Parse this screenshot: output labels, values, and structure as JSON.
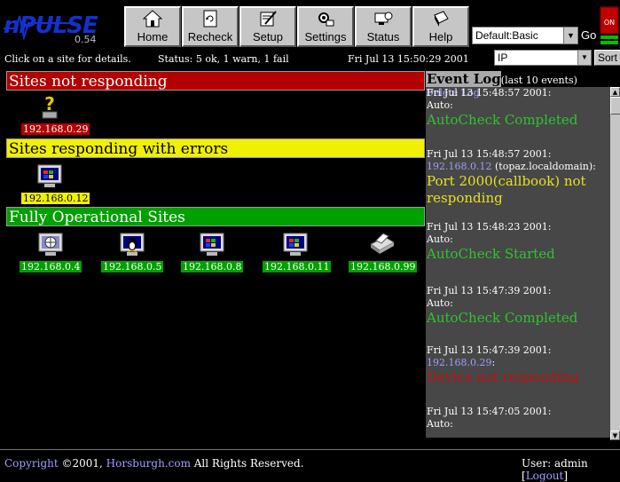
{
  "header": {
    "logo_text": "nPULSE",
    "version": "0.54",
    "nav": [
      {
        "label": "Home",
        "icon": "house-icon"
      },
      {
        "label": "Recheck",
        "icon": "recheck-icon"
      },
      {
        "label": "Setup",
        "icon": "setup-icon"
      },
      {
        "label": "Settings",
        "icon": "settings-icon"
      },
      {
        "label": "Status",
        "icon": "status-icon"
      },
      {
        "label": "Help",
        "icon": "help-book-icon"
      }
    ],
    "view_select": "Default:Basic",
    "go_label": "Go",
    "power_label": "ON"
  },
  "statusbar": {
    "hint": "Click on a site for details.",
    "status": "Status: 5 ok, 1 warn, 1 fail",
    "datetime": "Fri Jul 13 15:50:29 2001",
    "sort_select": "IP",
    "sort_button": "Sort"
  },
  "sections": {
    "down_title": "Sites not responding",
    "warn_title": "Sites responding with errors",
    "ok_title": "Fully Operational Sites"
  },
  "sites": {
    "down": [
      {
        "ip": "192.168.0.29",
        "icon": "unknown-device-icon"
      }
    ],
    "warn": [
      {
        "ip": "192.168.0.12",
        "icon": "windows-computer-icon"
      }
    ],
    "ok": [
      {
        "ip": "192.168.0.4",
        "icon": "network-computer-icon"
      },
      {
        "ip": "192.168.0.5",
        "icon": "linux-computer-icon"
      },
      {
        "ip": "192.168.0.8",
        "icon": "windows-computer-icon"
      },
      {
        "ip": "192.168.0.11",
        "icon": "windows-computer-icon"
      },
      {
        "ip": "192.168.0.99",
        "icon": "printer-icon"
      }
    ]
  },
  "eventlog": {
    "title": "Event Log",
    "subtitle": "(last 10 events)",
    "delete_label": "Delete Log",
    "events": [
      {
        "ts": "Fri Jul 13 15:48:57 2001:",
        "ip": "",
        "host_rest": "Auto:",
        "msg": "AutoCheck Completed",
        "level": "green"
      },
      {
        "ts": "Fri Jul 13 15:48:57 2001:",
        "ip": "192.168.0.12",
        "host_rest": " (topaz.localdomain):",
        "msg": "Port 2000(callbook) not responding",
        "level": "yellow"
      },
      {
        "ts": "Fri Jul 13 15:48:23 2001:",
        "ip": "",
        "host_rest": "Auto:",
        "msg": "AutoCheck Started",
        "level": "green"
      },
      {
        "ts": "Fri Jul 13 15:47:39 2001:",
        "ip": "",
        "host_rest": "Auto:",
        "msg": "AutoCheck Completed",
        "level": "green"
      },
      {
        "ts": "Fri Jul 13 15:47:39 2001:",
        "ip": "192.168.0.29",
        "host_rest": ":",
        "msg": "Device not responding",
        "level": "red"
      },
      {
        "ts": "Fri Jul 13 15:47:05 2001:",
        "ip": "",
        "host_rest": "Auto:",
        "msg": "",
        "level": "green"
      }
    ]
  },
  "footer": {
    "copyright_link": "Copyright",
    "year_text": " ©2001, ",
    "company_link": "Horsburgh.com",
    "rights": " All Rights Reserved.",
    "user_text": "User: admin ",
    "logout_link": "Logout"
  }
}
